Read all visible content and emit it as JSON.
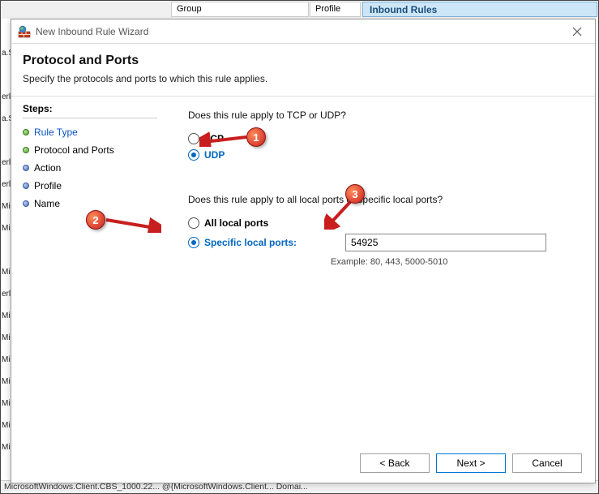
{
  "background": {
    "col_group": "Group",
    "col_profile": "Profile",
    "inbound_rules": "Inbound Rules",
    "left_items": [
      "",
      "a.S",
      "",
      "erl",
      "a.S",
      "",
      "erl",
      "erl",
      "Mic",
      "Mic",
      "",
      "Mic",
      "erl",
      "Mic",
      "Mic",
      "Mic",
      "Mic",
      "Mic",
      "Mic",
      "Mic"
    ],
    "statusbar": "MicrosoftWindows.Client.CBS_1000.22...   @{MicrosoftWindows.Client...   Domai..."
  },
  "dialog": {
    "title": "New Inbound Rule Wizard",
    "page_title": "Protocol and Ports",
    "page_subtitle": "Specify the protocols and ports to which this rule applies.",
    "steps_heading": "Steps:",
    "steps": [
      {
        "label": "Rule Type",
        "status": "done"
      },
      {
        "label": "Protocol and Ports",
        "status": "current"
      },
      {
        "label": "Action",
        "status": "pending"
      },
      {
        "label": "Profile",
        "status": "pending"
      },
      {
        "label": "Name",
        "status": "pending"
      }
    ],
    "q1": "Does this rule apply to TCP or UDP?",
    "protocol": {
      "tcp": "TCP",
      "udp": "UDP",
      "selected": "udp"
    },
    "q2": "Does this rule apply to all local ports or specific local ports?",
    "ports": {
      "all": "All local ports",
      "specific": "Specific local ports:",
      "selected": "specific",
      "value": "54925",
      "example": "Example: 80, 443, 5000-5010"
    },
    "buttons": {
      "back": "< Back",
      "next": "Next >",
      "cancel": "Cancel"
    }
  },
  "annotations": {
    "c1": "1",
    "c2": "2",
    "c3": "3"
  }
}
